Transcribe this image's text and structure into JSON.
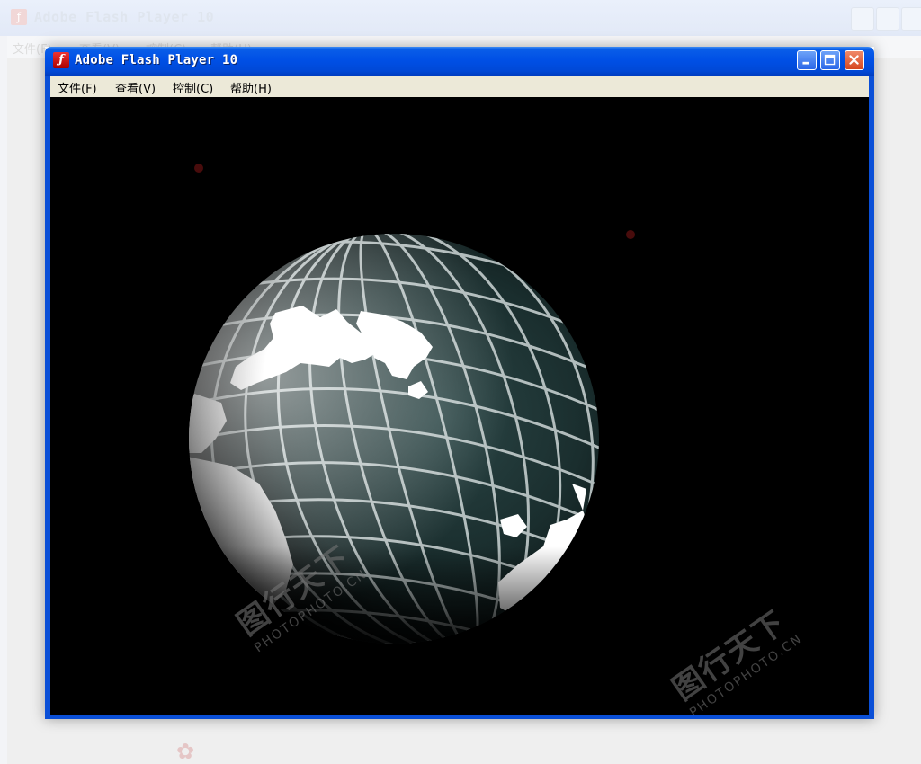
{
  "window": {
    "title": "Adobe Flash Player 10",
    "app_icon": "flash-icon",
    "controls": [
      "minimize-icon",
      "maximize-icon",
      "close-icon"
    ]
  },
  "background_window": {
    "title": "Adobe Flash Player 10",
    "menu": [
      "文件(F)",
      "查看(V)",
      "控制(C)",
      "帮助(H)"
    ]
  },
  "menu": {
    "items": [
      {
        "label": "文件(F)"
      },
      {
        "label": "查看(V)"
      },
      {
        "label": "控制(C)"
      },
      {
        "label": "帮助(H)"
      }
    ]
  },
  "watermarks": [
    {
      "cn": "图行天下",
      "en": "PHOTOPHOTO.CN"
    },
    {
      "cn": "图行天下",
      "en": "PHOTOPHOTO.CN"
    }
  ],
  "colors": {
    "titlebar": "#0050e6",
    "menubar": "#ece9d8",
    "stage": "#000000",
    "globe_ocean": "#1e3232",
    "globe_grid": "#d8e0e0",
    "land": "#ffffff"
  }
}
